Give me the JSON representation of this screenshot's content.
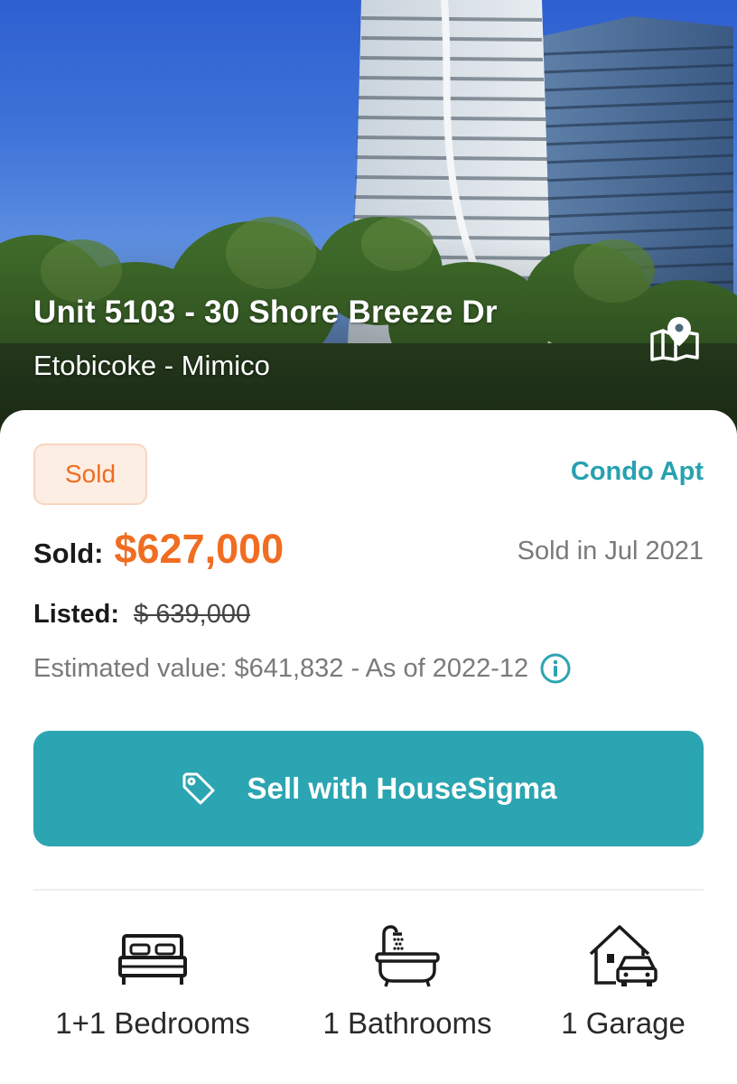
{
  "listing": {
    "title": "Unit 5103 - 30 Shore Breeze Dr",
    "subtitle": "Etobicoke - Mimico",
    "status": "Sold",
    "property_type": "Condo Apt",
    "sold_label": "Sold:",
    "sold_price": "$627,000",
    "sold_date": "Sold in Jul 2021",
    "listed_label": "Listed:",
    "listed_price": "$ 639,000",
    "estimated_value": "Estimated value: $641,832 - As of 2022-12"
  },
  "actions": {
    "sell_button": "Sell with HouseSigma"
  },
  "features": [
    {
      "label": "1+1 Bedrooms",
      "icon": "bed-icon"
    },
    {
      "label": "1 Bathrooms",
      "icon": "bathtub-icon"
    },
    {
      "label": "1 Garage",
      "icon": "garage-icon"
    }
  ],
  "colors": {
    "accent_teal": "#2ba5b1",
    "price_orange": "#f06d21",
    "badge_bg": "#fdeee4"
  }
}
